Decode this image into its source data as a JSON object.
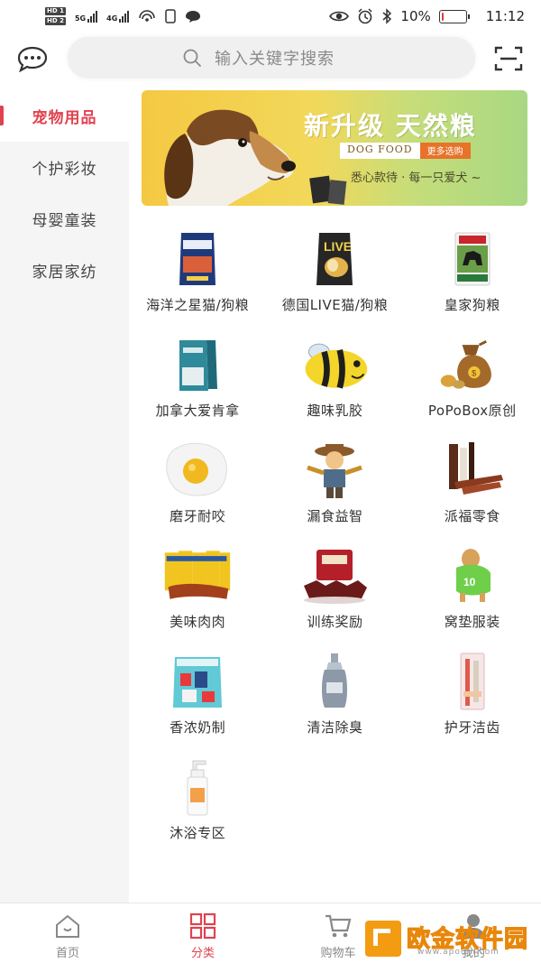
{
  "status_bar": {
    "hd1": "HD 1",
    "hd2": "HD 2",
    "net1": "5G",
    "net2": "4G",
    "battery_percent": "10%",
    "battery_level": 0.1,
    "time": "11:12"
  },
  "header": {
    "search_placeholder": "输入关键字搜索"
  },
  "sidebar": {
    "items": [
      {
        "label": "宠物用品",
        "active": true
      },
      {
        "label": "个护彩妆",
        "active": false
      },
      {
        "label": "母婴童装",
        "active": false
      },
      {
        "label": "家居家纺",
        "active": false
      }
    ]
  },
  "banner": {
    "title": "新升级  天然粮",
    "badge_left": "DOG FOOD",
    "badge_right": "更多选购",
    "subtitle": "悉心款待 · 每一只爱犬 ~"
  },
  "categories": [
    {
      "label": "海洋之星猫/狗粮",
      "icon": "cat-dog-food-bag-icon"
    },
    {
      "label": "德国LIVE猫/狗粮",
      "icon": "live-food-bag-icon"
    },
    {
      "label": "皇家狗粮",
      "icon": "royal-dog-food-icon"
    },
    {
      "label": "加拿大爱肯拿",
      "icon": "acana-food-bag-icon"
    },
    {
      "label": "趣味乳胶",
      "icon": "bee-latex-toy-icon"
    },
    {
      "label": "PoPoBox原创",
      "icon": "money-bag-toy-icon"
    },
    {
      "label": "磨牙耐咬",
      "icon": "egg-chew-toy-icon"
    },
    {
      "label": "漏食益智",
      "icon": "scarecrow-toy-icon"
    },
    {
      "label": "派福零食",
      "icon": "jerky-sticks-icon"
    },
    {
      "label": "美味肉肉",
      "icon": "meat-snack-packs-icon"
    },
    {
      "label": "训练奖励",
      "icon": "beef-treats-icon"
    },
    {
      "label": "窝垫服装",
      "icon": "dog-clothing-icon"
    },
    {
      "label": "香浓奶制",
      "icon": "milk-treat-bag-icon"
    },
    {
      "label": "清洁除臭",
      "icon": "cleaner-spray-bottle-icon"
    },
    {
      "label": "护牙洁齿",
      "icon": "toothbrush-set-icon"
    },
    {
      "label": "沐浴专区",
      "icon": "shampoo-pump-bottle-icon"
    }
  ],
  "tabbar": {
    "items": [
      {
        "label": "首页",
        "icon": "home-icon",
        "active": false
      },
      {
        "label": "分类",
        "icon": "category-grid-icon",
        "active": true
      },
      {
        "label": "购物车",
        "icon": "cart-icon",
        "active": false
      },
      {
        "label": "我的",
        "icon": "profile-icon",
        "active": false
      }
    ]
  },
  "watermark": {
    "text": "欧金软件园",
    "url": "www.apoujn.com"
  },
  "colors": {
    "accent": "#e0424f",
    "sidebar_bg": "#f5f5f5",
    "banner_yellow": "#f5c842",
    "banner_green": "#a9d882"
  }
}
